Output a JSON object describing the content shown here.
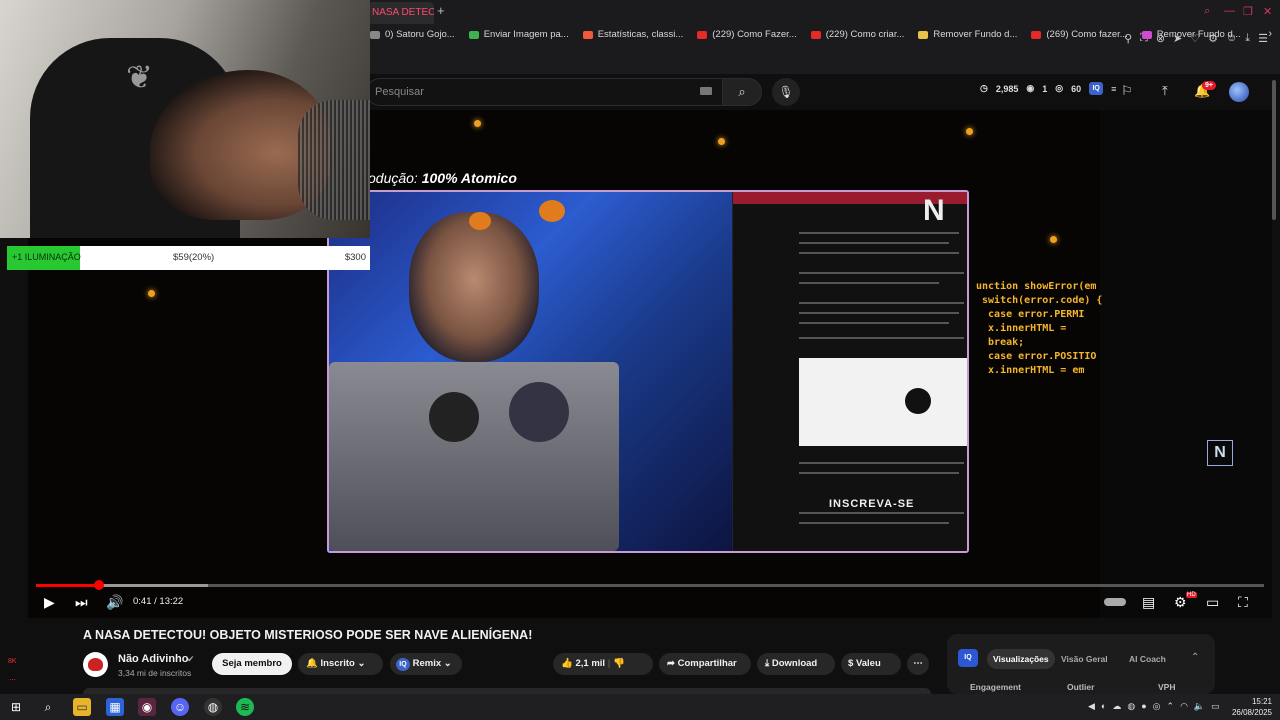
{
  "browser": {
    "active_tab_title": "NASA DETECTOU",
    "new_tab_symbol": "+",
    "bookmarks": [
      {
        "label": "0) Satoru Gojo...",
        "color": "#888888"
      },
      {
        "label": "Enviar Imagem pa...",
        "color": "#3fb24f"
      },
      {
        "label": "Estatísticas, classi...",
        "color": "#ef5b3a"
      },
      {
        "label": "(229) Como Fazer...",
        "color": "#e52a2a"
      },
      {
        "label": "(229) Como criar...",
        "color": "#e52a2a"
      },
      {
        "label": "Remover Fundo d...",
        "color": "#e8c34a"
      },
      {
        "label": "(269) Como fazer...",
        "color": "#e52a2a"
      },
      {
        "label": "Remover Fundo d...",
        "color": "#d04bd0"
      }
    ]
  },
  "youtube_header": {
    "search_placeholder": "Pesquisar",
    "stats": {
      "points": "2,985",
      "watching": "1",
      "viewers": "60"
    },
    "notification_count": "9+"
  },
  "video": {
    "overlay_text_prefix": "odução:",
    "overlay_text_value": "100% Atomico",
    "subscribe_text": "INSCREVA-SE",
    "code_overlay": "unction showError(em\n switch(error.code) {\n  case error.PERMI\n  x.innerHTML =\n  break;\n  case error.POSITIO\n  x.innerHTML = em",
    "current_time": "0:41",
    "duration": "13:22",
    "played_fraction": 0.051,
    "buffered_fraction": 0.14
  },
  "goal_bar": {
    "label": "+1 ILUMINAÇÃO",
    "progress_text": "$59(20%)",
    "max_text": "$300",
    "progress_fraction": 0.2
  },
  "below": {
    "title": "A NASA DETECTOU! OBJETO MISTERIOSO PODE SER NAVE ALIENÍGENA!",
    "channel_name": "Não Adivinho",
    "subscribers": "3,34 mi de inscritos",
    "member_button": "Seja membro",
    "subscribed_button": "Inscrito",
    "remix_button": "Remix",
    "likes": "2,1 mil",
    "share_button": "Compartilhar",
    "download_button": "Download",
    "thanks_button": "Valeu",
    "more_button": "⋯"
  },
  "panel": {
    "tabs": [
      "Visualizações",
      "Visão Geral",
      "AI Coach"
    ],
    "active_tab": "Visualizações",
    "columns": [
      "Engagement",
      "Outlier",
      "VPH"
    ]
  },
  "left_strip": {
    "badge": "8K"
  },
  "taskbar": {
    "time": "15:21",
    "date": "26/08/2025"
  }
}
